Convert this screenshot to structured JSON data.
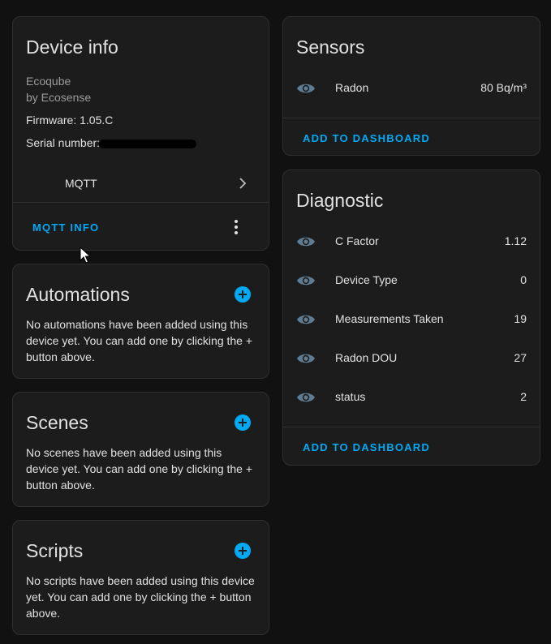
{
  "device_info": {
    "title": "Device info",
    "model": "Ecoqube",
    "manufacturer": "by Ecosense",
    "firmware": "Firmware: 1.05.C",
    "serial_label": "Serial number:",
    "integration": "MQTT",
    "action": "MQTT INFO"
  },
  "automations": {
    "title": "Automations",
    "description": "No automations have been added using this device yet. You can add one by clicking the + button above."
  },
  "scenes": {
    "title": "Scenes",
    "description": "No scenes have been added using this device yet. You can add one by clicking the + button above."
  },
  "scripts": {
    "title": "Scripts",
    "description": "No scripts have been added using this device yet. You can add one by clicking the + button above."
  },
  "sensors": {
    "title": "Sensors",
    "items": [
      {
        "name": "Radon",
        "value": "80 Bq/m³"
      }
    ],
    "action": "ADD TO DASHBOARD"
  },
  "diagnostic": {
    "title": "Diagnostic",
    "items": [
      {
        "name": "C Factor",
        "value": "1.12"
      },
      {
        "name": "Device Type",
        "value": "0"
      },
      {
        "name": "Measurements Taken",
        "value": "19"
      },
      {
        "name": "Radon DOU",
        "value": "27"
      },
      {
        "name": "status",
        "value": "2"
      }
    ],
    "action": "ADD TO DASHBOARD"
  },
  "colors": {
    "background": "#111111",
    "card": "#1c1c1c",
    "accent": "#03a9f4",
    "icon": "#5e7d94",
    "redaction": "#000000"
  },
  "icons": [
    "eye-icon",
    "chevron-right-icon",
    "plus-circle-icon",
    "kebab-menu-icon",
    "mouse-cursor-icon"
  ]
}
